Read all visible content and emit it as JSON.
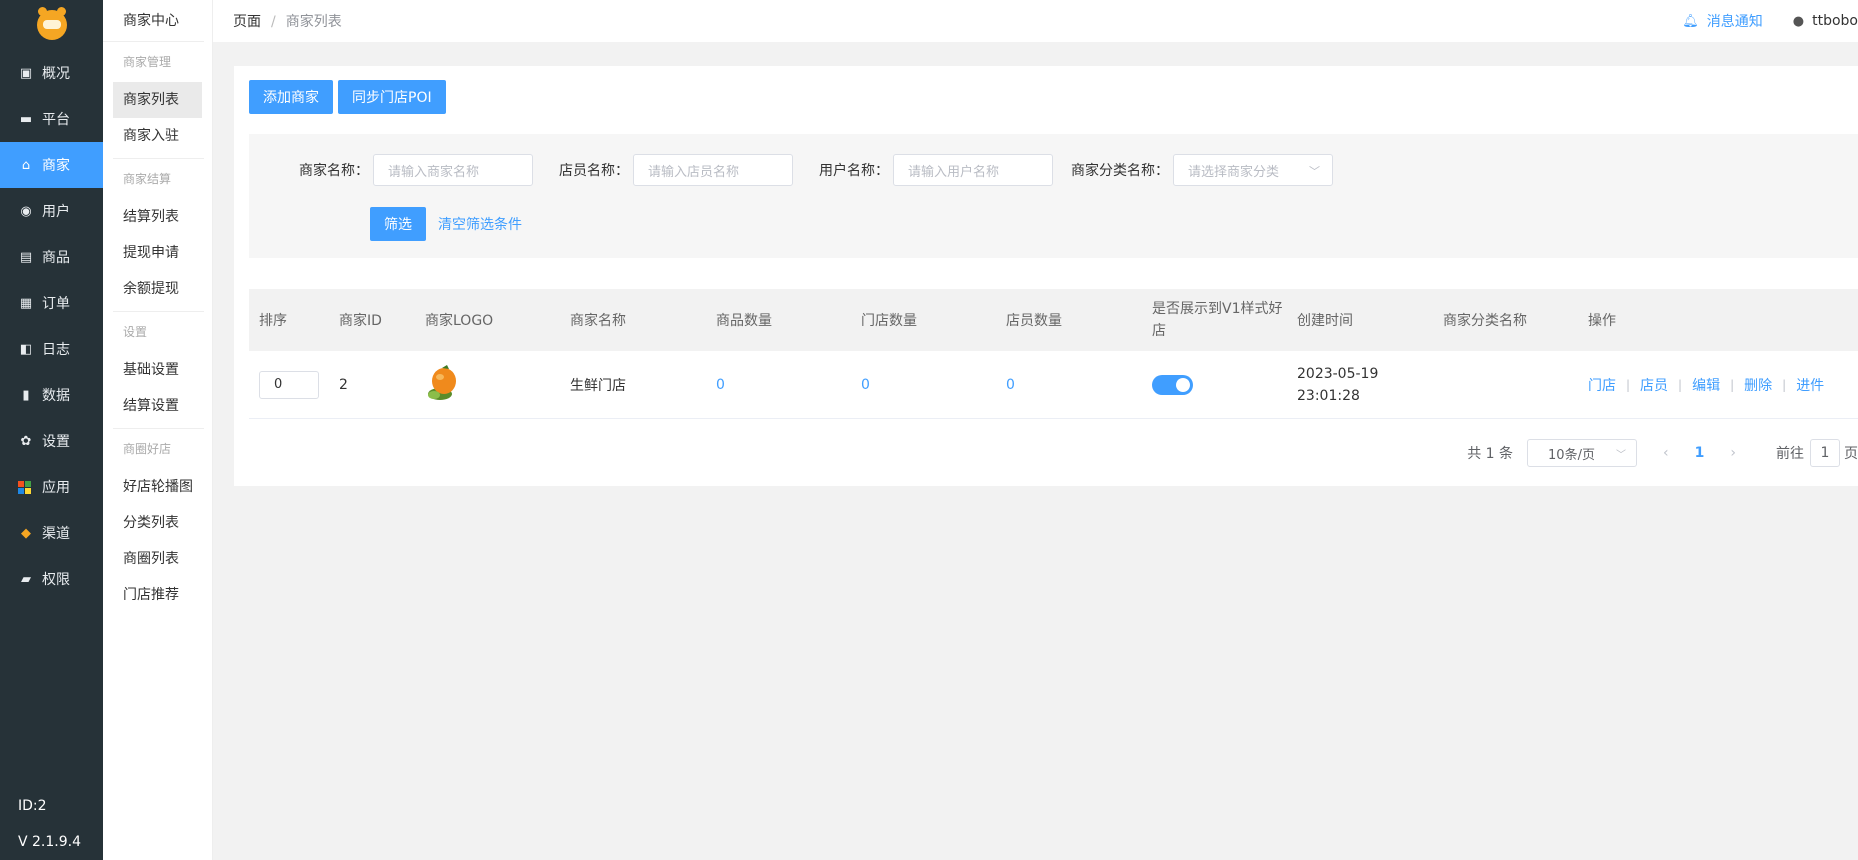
{
  "sidebar": {
    "items": [
      {
        "label": "概况",
        "icon": "monitor-chart-icon"
      },
      {
        "label": "平台",
        "icon": "desktop-icon"
      },
      {
        "label": "商家",
        "icon": "shop-icon"
      },
      {
        "label": "用户",
        "icon": "user-icon"
      },
      {
        "label": "商品",
        "icon": "goods-icon"
      },
      {
        "label": "订单",
        "icon": "order-icon"
      },
      {
        "label": "日志",
        "icon": "book-icon"
      },
      {
        "label": "数据",
        "icon": "bar-chart-icon"
      },
      {
        "label": "设置",
        "icon": "gear-icon"
      },
      {
        "label": "应用",
        "icon": "apps-icon"
      },
      {
        "label": "渠道",
        "icon": "cube-icon"
      },
      {
        "label": "权限",
        "icon": "lock-icon"
      }
    ],
    "id_text": "ID:2",
    "version": "V 2.1.9.4"
  },
  "subnav": {
    "title": "商家中心",
    "group1": "商家管理",
    "item_list": "商家列表",
    "item_join": "商家入驻",
    "group2": "商家结算",
    "item_settle_list": "结算列表",
    "item_withdraw_apply": "提现申请",
    "item_balance_withdraw": "余额提现",
    "group3": "设置",
    "item_basic": "基础设置",
    "item_settle_setting": "结算设置",
    "group4": "商圈好店",
    "item_banner": "好店轮播图",
    "item_category": "分类列表",
    "item_circle": "商圈列表",
    "item_recommend": "门店推荐"
  },
  "header": {
    "crumb_root": "页面",
    "crumb_sep": "/",
    "crumb_current": "商家列表",
    "notify": "消息通知",
    "username": "ttbobo"
  },
  "toolbar": {
    "add_label": "添加商家",
    "sync_label": "同步门店POI"
  },
  "filter": {
    "merchant_name_label": "商家名称：",
    "merchant_name_placeholder": "请输入商家名称",
    "clerk_name_label": "店员名称：",
    "clerk_name_placeholder": "请输入店员名称",
    "user_name_label": "用户名称：",
    "user_name_placeholder": "请输入用户名称",
    "category_label": "商家分类名称：",
    "category_placeholder": "请选择商家分类",
    "filter_btn": "筛选",
    "clear_btn": "清空筛选条件"
  },
  "table": {
    "headers": {
      "sort": "排序",
      "id": "商家ID",
      "logo": "商家LOGO",
      "name": "商家名称",
      "goods_count": "商品数量",
      "store_count": "门店数量",
      "clerk_count": "店员数量",
      "v1_show": "是否展示到V1样式好店",
      "created": "创建时间",
      "category": "商家分类名称",
      "ops": "操作"
    },
    "rows": [
      {
        "sort": "0",
        "id": "2",
        "name": "生鲜门店",
        "goods_count": "0",
        "store_count": "0",
        "clerk_count": "0",
        "v1_show": true,
        "created": "2023-05-19 23:01:28",
        "category": "",
        "op_store": "门店",
        "op_clerk": "店员",
        "op_edit": "编辑",
        "op_delete": "删除",
        "op_enter": "进件",
        "op_sep": "|"
      }
    ]
  },
  "pager": {
    "total": "共 1 条",
    "page_size": "10条/页",
    "current": "1",
    "goto_label": "前往",
    "goto_value": "1",
    "page_unit": "页"
  },
  "colors": {
    "primary": "#409eff",
    "sidebar_bg": "#263238"
  }
}
